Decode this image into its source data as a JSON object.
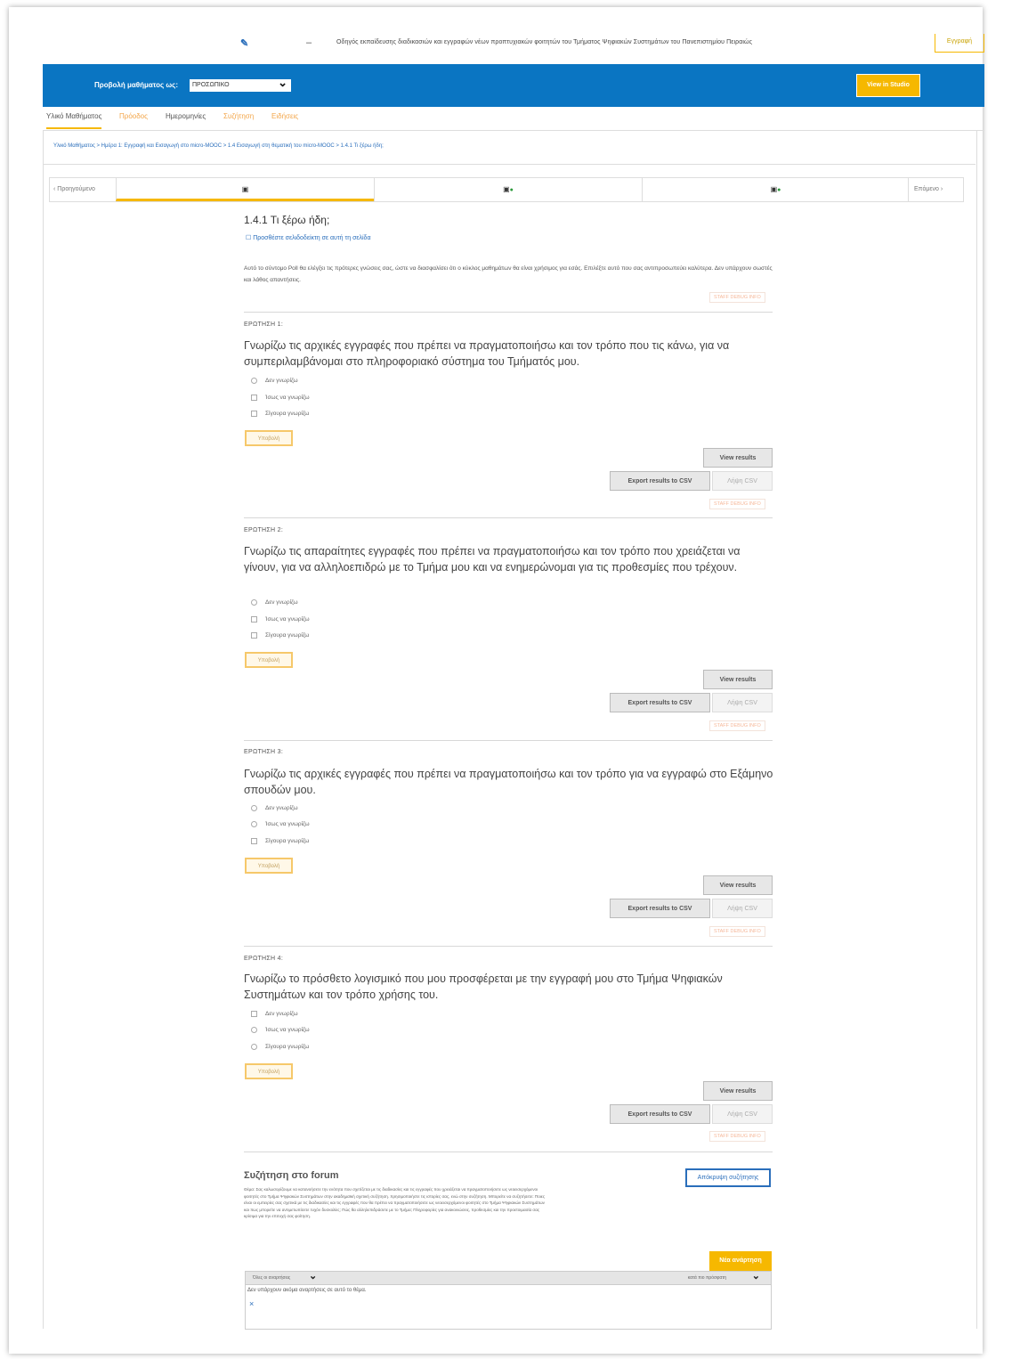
{
  "header": {
    "logo_glyph": "✎",
    "dash": "–",
    "course_title": "Οδηγός εκπαίδευσης διαδικασιών και εγγραφών νέων προπτυχιακών φοιτητών του Τμήματος Ψηφιακών Συστημάτων του Πανεπιστημίου Πειραιώς",
    "user_button": "Εγγραφή"
  },
  "bar": {
    "view_as_label": "Προβολή μαθήματος ως:",
    "view_as_value": "ΠΡΟΣΩΠΙΚΟ",
    "chevron": "⌄",
    "studio_button": "View in Studio",
    "accent_color": "#f6b800",
    "bar_color": "#0a75c2"
  },
  "tabs": [
    {
      "label": "Υλικό Μαθήματος"
    },
    {
      "label": "Πρόοδος"
    },
    {
      "label": "Ημερομηνίες"
    },
    {
      "label": "Συζήτηση"
    },
    {
      "label": "Ειδήσεις"
    }
  ],
  "breadcrumb": "Υλικό Μαθήματος > Ημέρα 1: Εγγραφή και Εισαγωγή στο micro-MOOC > 1.4 Εισαγωγή στη θεματική του micro-MOOC > 1.4.1 Τι ξέρω ήδη;",
  "seqnav": {
    "prev": "Προηγούμενο",
    "next": "Επόμενο",
    "unit_icon": "▣",
    "done_icon": "●"
  },
  "unit": {
    "title": "1.4.1 Τι ξέρω ήδη;",
    "bookmark": "☐ Προσθέστε σελιδοδείκτη σε αυτή τη σελίδα",
    "intro": "Αυτό το σύντομο Poll θα ελέγξει τις πρότερες γνώσεις σας, ώστε να διασφαλίσει ότι ο κύκλος μαθημάτων θα είναι χρήσιμος για εσάς. Επιλέξτε αυτό που σας αντιπροσωπεύει καλύτερα. Δεν υπάρχουν σωστές και λάθος απαντήσεις.",
    "staff_debug": "STAFF DEBUG INFO"
  },
  "questions": [
    {
      "label": "ΕΡΩΤΗΣΗ 1:",
      "text": "Γνωρίζω τις αρχικές εγγραφές που πρέπει να πραγματοποιήσω και τον τρόπο που τις κάνω, για να συμπεριλαμβάνομαι στο πληροφοριακό σύστημα του Τμήματός μου.",
      "options": [
        "Δεν γνωρίζω",
        "Ίσως να γνωρίζω",
        "Σίγουρα γνωρίζω"
      ]
    },
    {
      "label": "ΕΡΩΤΗΣΗ 2:",
      "text": "Γνωρίζω τις απαραίτητες εγγραφές που πρέπει να πραγματοποιήσω και τον τρόπο που χρειάζεται να γίνουν, για να αλληλοεπιδρώ με το Τμήμα μου και να ενημερώνομαι για τις προθεσμίες που τρέχουν.",
      "options": [
        "Δεν γνωρίζω",
        "Ίσως να γνωρίζω",
        "Σίγουρα γνωρίζω"
      ]
    },
    {
      "label": "ΕΡΩΤΗΣΗ 3:",
      "text": "Γνωρίζω τις αρχικές εγγραφές που πρέπει να πραγματοποιήσω και τον τρόπο για να εγγραφώ στο Εξάμηνο σπουδών μου.",
      "options": [
        "Δεν γνωρίζω",
        "Ίσως να γνωρίζω",
        "Σίγουρα γνωρίζω"
      ]
    },
    {
      "label": "ΕΡΩΤΗΣΗ 4:",
      "text": "Γνωρίζω το πρόσθετο λογισμικό που μου προσφέρεται με την εγγραφή μου στο Τμήμα Ψηφιακών Συστημάτων και τον τρόπο χρήσης του.",
      "options": [
        "Δεν γνωρίζω",
        "Ίσως να γνωρίζω",
        "Σίγουρα γνωρίζω"
      ]
    }
  ],
  "buttons": {
    "submit": "Υποβολή",
    "view_results": "View results",
    "export_csv": "Export results to CSV",
    "download_csv": "Λήψη CSV"
  },
  "forum": {
    "title": "Συζήτηση στο forum",
    "description": "Θέμα: Σας καλωσορίζουμε να κατανοήσετε την ενότητα που σχετίζεται με τις διαδικασίες και τις εγγραφές που χρειάζεται να πραγματοποιήσετε ως νεοεισερχόμενοι φοιτητές στο Τμήμα Ψηφιακών Συστημάτων στην ακαδημαϊκή σχετική συζήτηση. Χρησιμοποιήστε τις ιστορίες σας, ενώ στην συζήτηση. Μπορείτε να συζητήσετε: Ποιες είναι οι εμπειρίες σας σχετικά με τις διαδικασίες και τις εγγραφές που θα πρέπει να πραγματοποιήσετε ως νεοεισερχόμενοι φοιτητές στο Τμήμα Ψηφιακών Συστημάτων και πως μπορείτε να αντιμετωπίσετε τυχόν δυσκολίες; Πώς θα αλληλεπιδράσετε με το Τμήμα; Πληροφορίες για ανακοινώσεις, προθεσμίες και την προετοιμασία σας κρίσιμα για την επιτυχή σας φοίτηση.",
    "hide_button": "Απόκρυψη συζήτησης",
    "new_post": "Νέα ανάρτηση",
    "filter_all": "Όλες οι αναρτήσεις",
    "sort_label": "κατά πιο πρόσφατη",
    "empty": "Δεν υπάρχουν ακόμα αναρτήσεις σε αυτό το θέμα.",
    "close_x": "×"
  }
}
